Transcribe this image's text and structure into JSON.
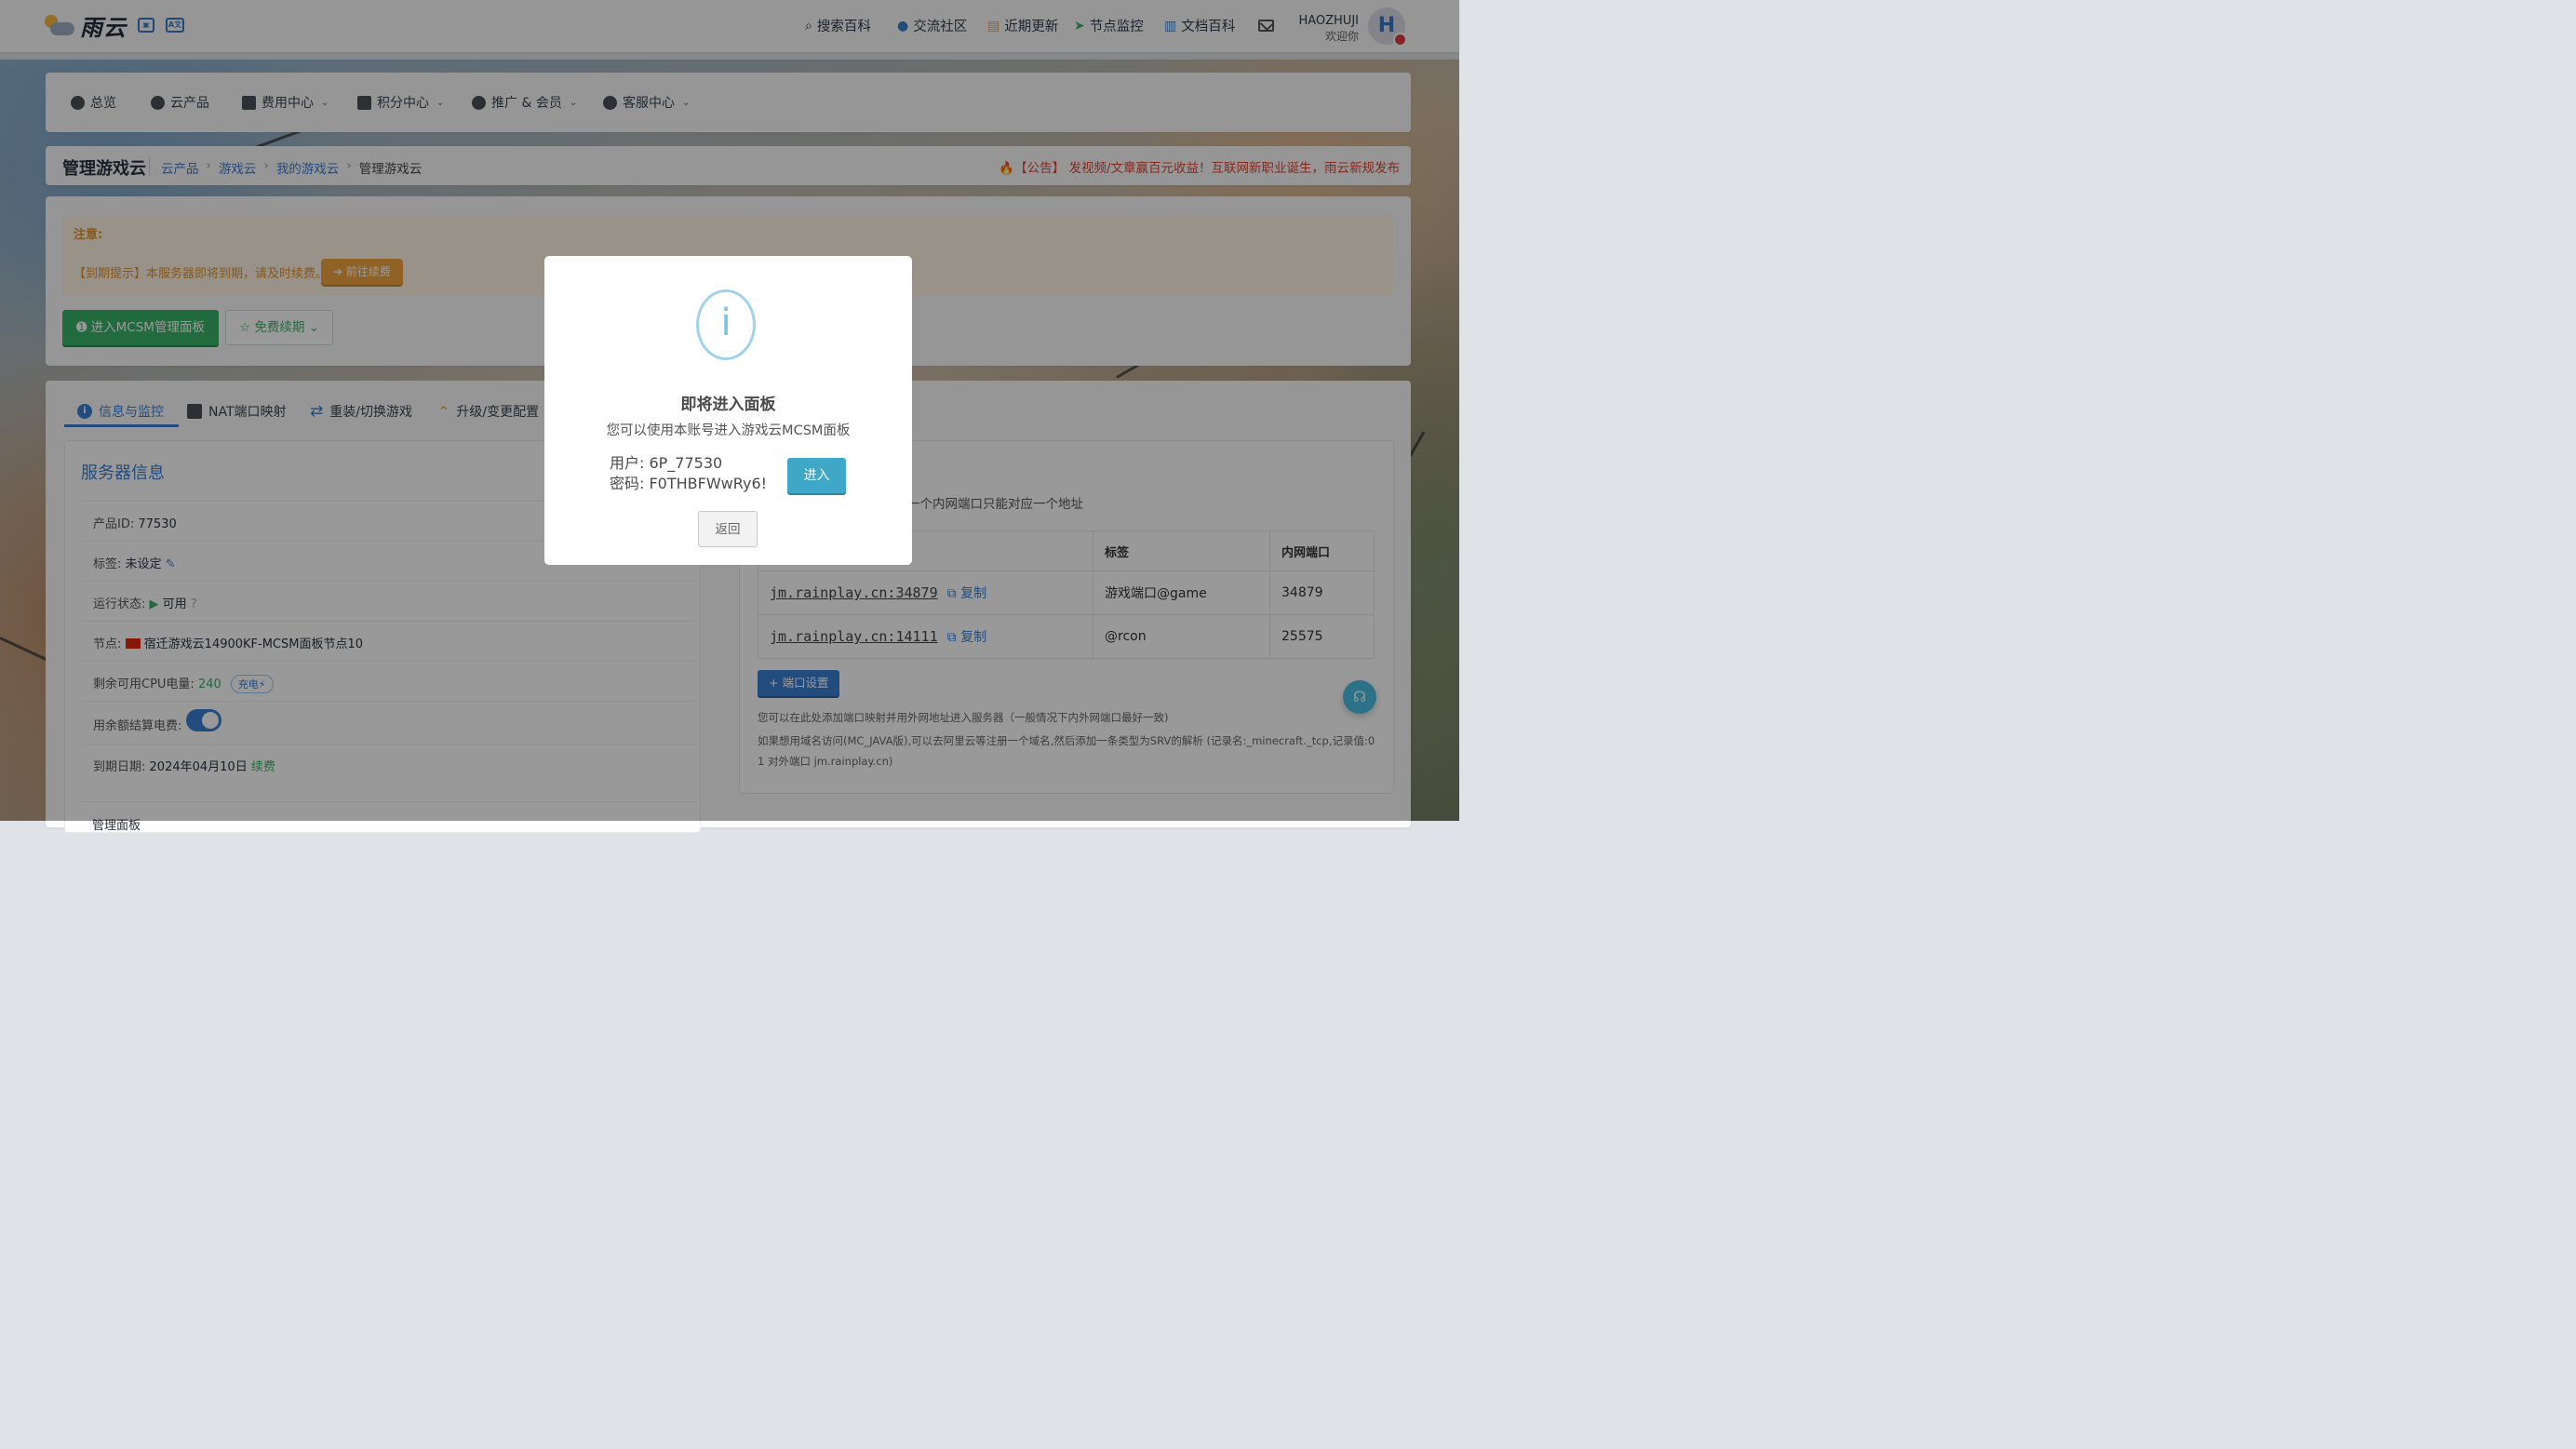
{
  "app": {
    "logo_text": "雨云",
    "mini_icons": [
      "image-icon",
      "translate-icon"
    ],
    "mini_icon_texts": [
      "▣",
      "A文"
    ]
  },
  "topnav": [
    {
      "label": "搜索百科",
      "icon": "search-icon",
      "glyph": "⌕"
    },
    {
      "label": "交流社区",
      "icon": "bell-icon",
      "glyph": "●"
    },
    {
      "label": "近期更新",
      "icon": "list-icon",
      "glyph": "▤"
    },
    {
      "label": "节点监控",
      "icon": "send-icon",
      "glyph": "➤"
    },
    {
      "label": "文档百科",
      "icon": "book-icon",
      "glyph": "▥"
    }
  ],
  "user": {
    "name": "HAOZHUJI",
    "welcome": "欢迎你",
    "avatar_letter": "H"
  },
  "menu": [
    {
      "label": "总览",
      "icon": "dashboard-icon",
      "caret": false
    },
    {
      "label": "云产品",
      "icon": "cubes-icon",
      "caret": false
    },
    {
      "label": "费用中心",
      "icon": "money-icon",
      "caret": true
    },
    {
      "label": "积分中心",
      "icon": "gift-icon",
      "caret": true
    },
    {
      "label": "推广 & 会员",
      "icon": "users-icon",
      "caret": true
    },
    {
      "label": "客服中心",
      "icon": "headset-icon",
      "caret": true
    }
  ],
  "breadcrumb": {
    "title": "管理游戏云",
    "path": [
      "云产品",
      "游戏云",
      "我的游戏云"
    ],
    "current": "管理游戏云",
    "notice": "🔥【公告】 发视频/文章赢百元收益！互联网新职业诞生，雨云新规发布"
  },
  "alert": {
    "heading": "注意:",
    "text": "【到期提示】本服务器即将到期，请及时续费。",
    "renew_label": "➔ 前往续费",
    "mcsm_label": "➊ 进入MCSM管理面板",
    "free_label": "☆ 免费续期 ⌄"
  },
  "tabs": [
    {
      "label": "信息与监控",
      "active": true
    },
    {
      "label": "NAT端口映射",
      "active": false
    },
    {
      "label": "重装/切换游戏",
      "active": false
    },
    {
      "label": "升级/变更配置",
      "active": false
    }
  ],
  "server": {
    "heading": "服务器信息",
    "product_id_label": "产品ID:",
    "product_id": "77530",
    "tag_label": "标签:",
    "tag": "未设定",
    "status_label": "运行状态:",
    "status": "可用",
    "node_label": "节点:",
    "node": "宿迁游戏云14900KF-MCSM面板节点10",
    "cpu_label": "剩余可用CPU电量:",
    "cpu": "240",
    "charge_label": "充电⚡",
    "balance_label": "用余额结算电费:",
    "expire_label": "到期日期:",
    "expire": "2024年04月10日",
    "renew_link": "续费",
    "mgmt_label": "管理面板"
  },
  "ports": {
    "desc": "一个内网端口只能对应一个地址",
    "headers": [
      "标签",
      "内网端口"
    ],
    "rows": [
      {
        "addr": "jm.rainplay.cn:34879",
        "copy": "复制",
        "tag": "游戏端口@game",
        "port": "34879"
      },
      {
        "addr": "jm.rainplay.cn:14111",
        "copy": "复制",
        "tag": "@rcon",
        "port": "25575"
      }
    ],
    "btn": "+ 端口设置",
    "tip1": "您可以在此处添加端口映射并用外网地址进入服务器（一般情况下内外网端口最好一致)",
    "tip2": "如果想用域名访问(MC_JAVA版),可以去阿里云等注册一个域名,然后添加一条类型为SRV的解析 (记录名:_minecraft._tcp,记录值:0 1 对外端口 jm.rainplay.cn)"
  },
  "modal": {
    "title": "即将进入面板",
    "subtitle": "您可以使用本账号进入游戏云MCSM面板",
    "user_line": "用户: 6P_77530",
    "pass_line": "密码: F0THBFWwRy6!",
    "enter_label": "进入",
    "back_label": "返回"
  },
  "colors": {
    "accent": "#3b7fd2",
    "success": "#39b26a",
    "warning": "#f0a440",
    "danger": "#e0452f",
    "modal_btn": "#3fa7c7"
  }
}
